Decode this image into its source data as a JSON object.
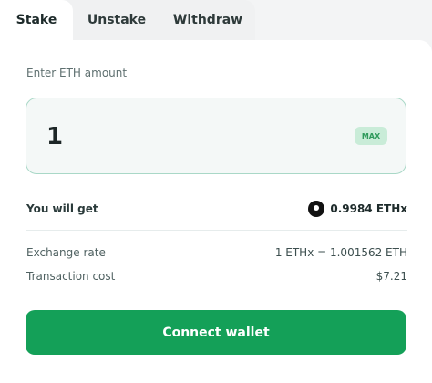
{
  "tabs": [
    {
      "label": "Stake",
      "active": true
    },
    {
      "label": "Unstake",
      "active": false
    },
    {
      "label": "Withdraw",
      "active": false
    }
  ],
  "form": {
    "enter_label": "Enter ETH amount",
    "amount_value": "1",
    "max_label": "MAX"
  },
  "summary": {
    "you_will_get_label": "You will get",
    "you_will_get_value": "0.9984 ETHx",
    "token_icon": "ethx-token-icon",
    "exchange_rate_label": "Exchange rate",
    "exchange_rate_value": "1 ETHx = 1.001562 ETH",
    "transaction_cost_label": "Transaction cost",
    "transaction_cost_value": "$7.21"
  },
  "actions": {
    "connect_label": "Connect wallet"
  },
  "colors": {
    "accent": "#14a058",
    "input_border": "#a9d8c7",
    "max_bg": "#c9ecd8"
  }
}
